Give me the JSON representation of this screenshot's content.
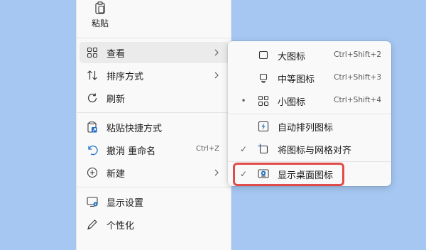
{
  "colors": {
    "desktop_bg": "#a5c7f1",
    "menu_bg": "#f9f9f9",
    "hover_bg": "#ebebeb",
    "highlight_border": "#e14b4b",
    "accent": "#1f6fc5"
  },
  "context_menu": {
    "paste": {
      "label": "粘贴",
      "icon": "clipboard-icon"
    },
    "items": [
      {
        "label": "查看",
        "icon": "grid-icon",
        "submenu": true
      },
      {
        "label": "排序方式",
        "icon": "sort-arrows-icon",
        "submenu": true
      },
      {
        "label": "刷新",
        "icon": "refresh-icon"
      },
      {
        "label": "粘贴快捷方式",
        "icon": "paste-shortcut-icon"
      },
      {
        "label": "撤消 重命名",
        "icon": "undo-icon",
        "shortcut": "Ctrl+Z"
      },
      {
        "label": "新建",
        "icon": "plus-circle-icon",
        "submenu": true
      },
      {
        "label": "显示设置",
        "icon": "display-settings-icon"
      },
      {
        "label": "个性化",
        "icon": "pen-icon"
      }
    ]
  },
  "view_submenu": {
    "items": [
      {
        "label": "大图标",
        "shortcut": "Ctrl+Shift+2",
        "icon": "large-icons-icon",
        "mark": ""
      },
      {
        "label": "中等图标",
        "shortcut": "Ctrl+Shift+3",
        "icon": "medium-icons-icon",
        "mark": ""
      },
      {
        "label": "小图标",
        "shortcut": "Ctrl+Shift+4",
        "icon": "small-icons-icon",
        "mark": "•"
      },
      {
        "label": "自动排列图标",
        "icon": "auto-arrange-icon",
        "mark": ""
      },
      {
        "label": "将图标与网格对齐",
        "icon": "grid-align-icon",
        "mark": "✓"
      },
      {
        "label": "显示桌面图标",
        "icon": "show-desktop-icons-icon",
        "mark": "✓"
      }
    ]
  }
}
